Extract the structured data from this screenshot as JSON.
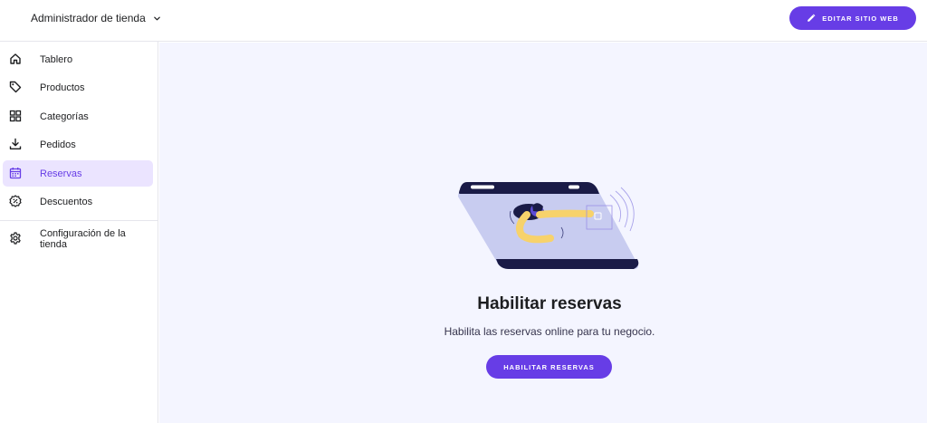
{
  "header": {
    "store_selector_label": "Administrador de tienda",
    "edit_site_button": "EDITAR SITIO WEB"
  },
  "sidebar": {
    "items": [
      {
        "label": "Tablero",
        "icon": "home-icon"
      },
      {
        "label": "Productos",
        "icon": "tag-icon"
      },
      {
        "label": "Categorías",
        "icon": "grid-icon"
      },
      {
        "label": "Pedidos",
        "icon": "download-icon"
      },
      {
        "label": "Reservas",
        "icon": "calendar-icon",
        "active": true
      },
      {
        "label": "Descuentos",
        "icon": "discount-badge-icon"
      },
      {
        "label": "Configuración de la tienda",
        "icon": "gear-icon"
      }
    ]
  },
  "main": {
    "title": "Habilitar reservas",
    "description": "Habilita las reservas online para tu negocio.",
    "enable_button": "HABILITAR RESERVAS"
  },
  "colors": {
    "accent": "#673de6",
    "active_bg": "#ebe4ff",
    "main_bg": "#f4f5ff",
    "text": "#1d1e20"
  }
}
